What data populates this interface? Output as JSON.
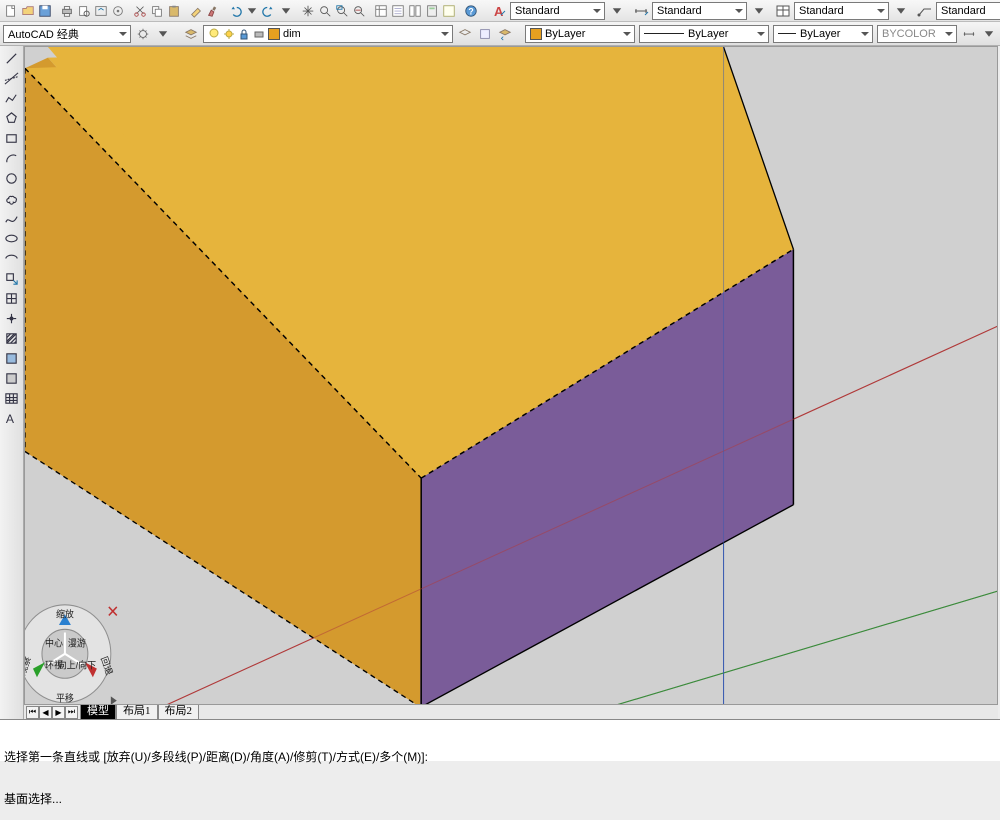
{
  "topstyles": {
    "s1": "Standard",
    "s2": "Standard",
    "s3": "Standard",
    "s4": "Standard"
  },
  "row2": {
    "workspace": "AutoCAD 经典",
    "layer": "dim",
    "prop_color": "ByLayer",
    "prop_linetype": "ByLayer",
    "prop_lineweight": "ByLayer",
    "prop_plotstyle": "BYCOLOR"
  },
  "tabs": {
    "active": "模型",
    "t1": "布局1",
    "t2": "布局2"
  },
  "cmd": {
    "l1": "选择第一条直线或 [放弃(U)/多段线(P)/距离(D)/角度(A)/修剪(T)/方式(E)/多个(M)]:",
    "l2": "基面选择..."
  },
  "colors": {
    "top": "#E6B43C",
    "left": "#D49A2E",
    "front": "#7A5C99",
    "bg": "#d0d0d0"
  },
  "navwheel": {
    "top": "缩放",
    "right": "回退",
    "bottom": "平移",
    "left": "动态观察",
    "c1": "中心",
    "c2": "环视",
    "c3": "向上/向下",
    "c4": "漫游"
  }
}
